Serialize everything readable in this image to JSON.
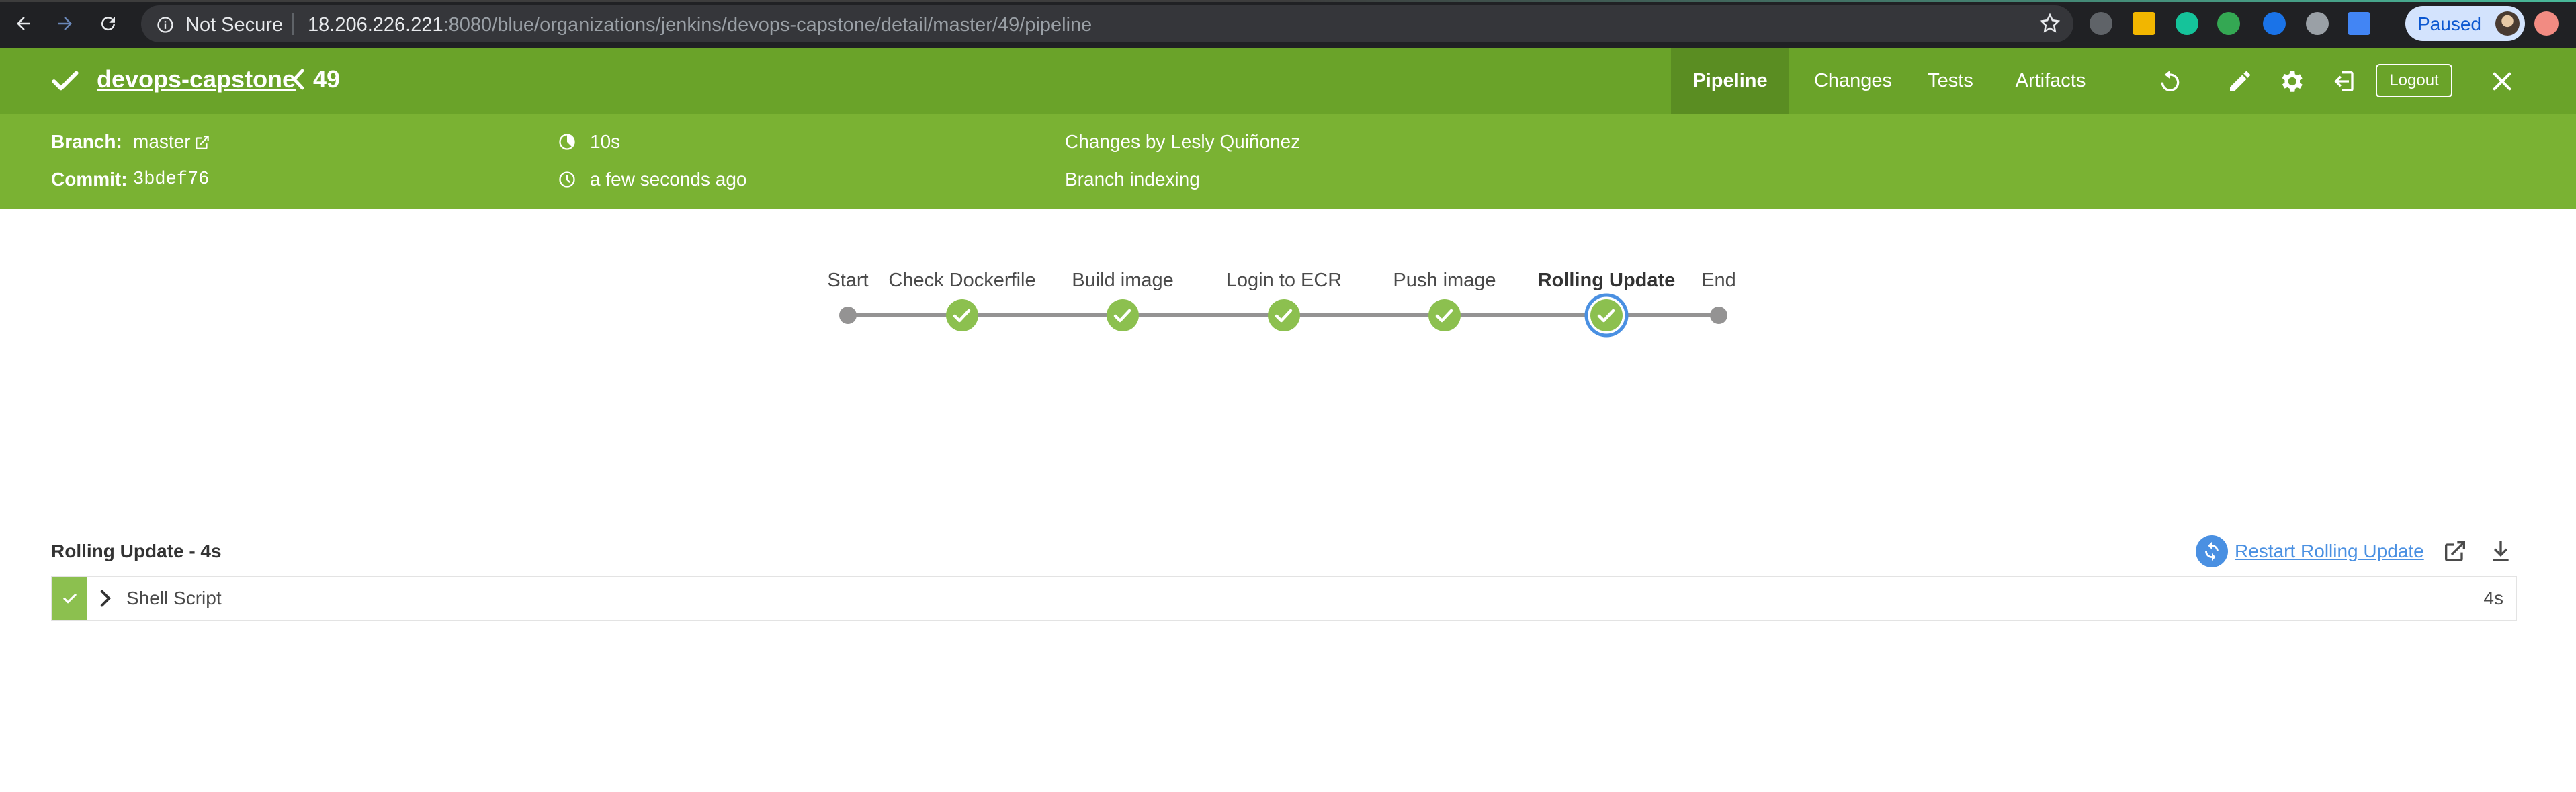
{
  "browser": {
    "security_label": "Not Secure",
    "url_host": "18.206.226.221",
    "url_rest": ":8080/blue/organizations/jenkins/devops-capstone/detail/master/49/pipeline",
    "profile_status": "Paused"
  },
  "header": {
    "pipeline_name": "devops-capstone",
    "run_number": "49",
    "tabs": [
      {
        "label": "Pipeline",
        "active": true
      },
      {
        "label": "Changes",
        "active": false
      },
      {
        "label": "Tests",
        "active": false
      },
      {
        "label": "Artifacts",
        "active": false
      }
    ],
    "logout_label": "Logout",
    "status_color": "#6aa329"
  },
  "run": {
    "branch_label": "Branch:",
    "branch_value": "master",
    "commit_label": "Commit:",
    "commit_value": "3bdef76",
    "duration": "10s",
    "started": "a few seconds ago",
    "changes": "Changes by Lesly Quiñonez",
    "cause": "Branch indexing"
  },
  "stages": [
    {
      "label": "Start",
      "status": "start"
    },
    {
      "label": "Check Dockerfile",
      "status": "success"
    },
    {
      "label": "Build image",
      "status": "success"
    },
    {
      "label": "Login to ECR",
      "status": "success"
    },
    {
      "label": "Push image",
      "status": "success"
    },
    {
      "label": "Rolling Update",
      "status": "success",
      "selected": true
    },
    {
      "label": "End",
      "status": "end"
    }
  ],
  "selected_stage": {
    "title": "Rolling Update - 4s",
    "restart_label": "Restart Rolling Update",
    "steps": [
      {
        "title": "Shell Script",
        "duration": "4s",
        "status": "success"
      }
    ]
  }
}
